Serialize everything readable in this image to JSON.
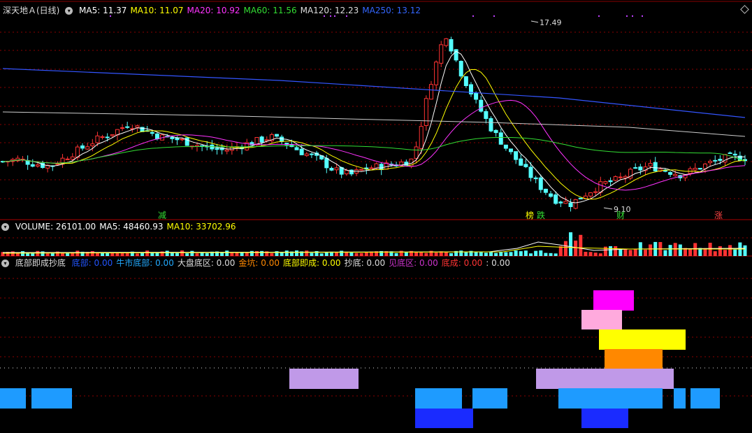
{
  "main": {
    "title": "深天地Ａ(日线)",
    "ma": [
      {
        "label": "MA5: 11.37",
        "color": "#ffffff"
      },
      {
        "label": "MA10: 11.07",
        "color": "#ffff00"
      },
      {
        "label": "MA20: 10.92",
        "color": "#ff33ff"
      },
      {
        "label": "MA60: 11.56",
        "color": "#33dd33"
      },
      {
        "label": "MA120: 12.23",
        "color": "#dddddd"
      },
      {
        "label": "MA250: 13.12",
        "color": "#3366ff"
      }
    ],
    "high_label": "17.49",
    "low_label": "9.10",
    "markers": [
      {
        "text": "减",
        "color": "#33dd33"
      },
      {
        "text": "榜",
        "color": "#ffff00"
      },
      {
        "text": "跌",
        "color": "#33dd33"
      },
      {
        "text": "财",
        "color": "#33dd33"
      },
      {
        "text": "涨",
        "color": "#ff4444"
      }
    ]
  },
  "volume": {
    "items": [
      {
        "label": "VOLUME: 26101.00",
        "color": "#ffffff"
      },
      {
        "label": "MA5: 48460.93",
        "color": "#ffffff"
      },
      {
        "label": "MA10: 33702.96",
        "color": "#ffff00"
      }
    ]
  },
  "indicator": {
    "title": "底部即成抄底",
    "items": [
      {
        "label": "底部: 0.00",
        "color": "#2255ff"
      },
      {
        "label": "牛市底部: 0.00",
        "color": "#22aaff"
      },
      {
        "label": "大盘底区: 0.00",
        "color": "#dddddd"
      },
      {
        "label": "金坑: 0.00",
        "color": "#ff8800"
      },
      {
        "label": "底部即成: 0.00",
        "color": "#ffff00"
      },
      {
        "label": "抄底: 0.00",
        "color": "#dddddd"
      },
      {
        "label": "见底区: 0.00",
        "color": "#cc33cc"
      },
      {
        "label": "底成: 0.00",
        "color": "#ff3333"
      },
      {
        "label": ": 0.00",
        "color": "#dddddd"
      }
    ]
  },
  "chart_data": {
    "type": "candlestick",
    "title": "深天地Ａ(日线)",
    "price_range": [
      9.1,
      17.49
    ],
    "sample_closes": [
      11.2,
      11.3,
      11.1,
      11.0,
      11.4,
      11.8,
      12.2,
      12.5,
      12.9,
      12.6,
      12.3,
      12.2,
      12.0,
      11.8,
      11.7,
      11.9,
      12.1,
      12.3,
      12.0,
      11.6,
      11.3,
      10.8,
      10.6,
      10.9,
      11.0,
      11.1,
      11.3,
      14.5,
      17.0,
      15.2,
      13.8,
      12.6,
      11.7,
      10.9,
      10.1,
      9.5,
      9.3,
      9.8,
      10.2,
      10.4,
      10.8,
      11.0,
      10.8,
      10.6,
      10.9,
      11.2,
      11.4,
      11.37
    ],
    "volume_ma5": 48460.93,
    "volume_ma10": 33702.96,
    "volume_last": 26101.0,
    "indicator_colors": {
      "底部": "#1a2bff",
      "牛市底部": "#1e9bff",
      "大盘底区": "#c099e8",
      "金坑": "#ff8800",
      "底部即成": "#ffff00",
      "抄底": "#ffaadd",
      "见底区": "#ff00ff"
    }
  }
}
